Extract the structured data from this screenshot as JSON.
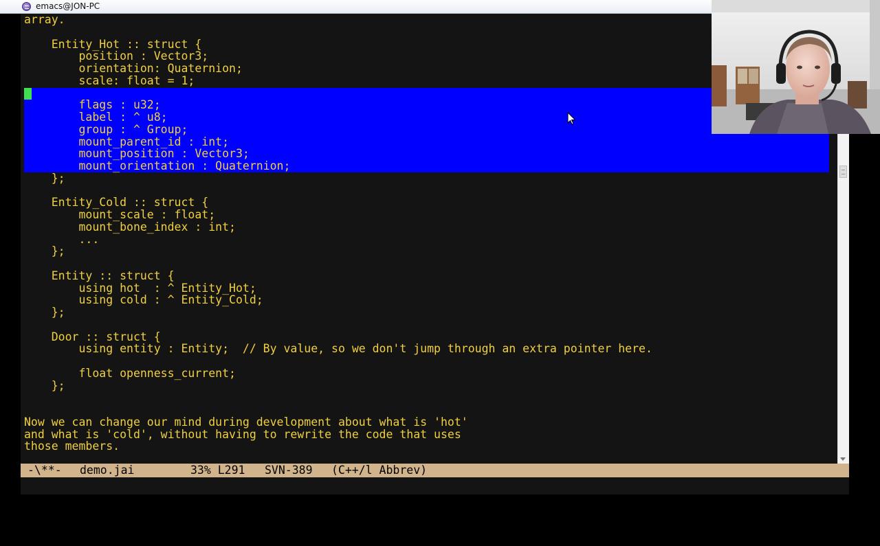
{
  "window": {
    "title": "emacs@JON-PC"
  },
  "buffer": {
    "lines": [
      "array.",
      "",
      "    Entity_Hot :: struct {",
      "        position : Vector3;",
      "        orientation: Quaternion;",
      "        scale: float = 1;",
      "",
      "        flags : u32;",
      "        label : ^ u8;",
      "        group : ^ Group;",
      "        mount_parent_id : int;",
      "        mount_position : Vector3;",
      "        mount_orientation : Quaternion;",
      "    };",
      "",
      "    Entity_Cold :: struct {",
      "        mount_scale : float;",
      "        mount_bone_index : int;",
      "        ...",
      "    };",
      "",
      "    Entity :: struct {",
      "        using hot  : ^ Entity_Hot;",
      "        using cold : ^ Entity_Cold;",
      "    };",
      "",
      "    Door :: struct {",
      "        using entity : Entity;  // By value, so we don't jump through an extra pointer here.",
      "",
      "        float openness_current;",
      "    };",
      "",
      "",
      "Now we can change our mind during development about what is 'hot'",
      "and what is 'cold', without having to rewrite the code that uses",
      "those members."
    ]
  },
  "modeline": {
    "status": "-\\**-",
    "buffer_name": "demo.jai",
    "position": "33% L291",
    "vcs": "SVN-389",
    "modes": "(C++/l Abbrev)"
  },
  "colors": {
    "text": "#f0d040",
    "background": "#141414",
    "selection": "#0000ff",
    "cursor": "#40e050",
    "modeline": "#d2b48c"
  },
  "webcam": {
    "description_icon": "webcam-feed"
  }
}
